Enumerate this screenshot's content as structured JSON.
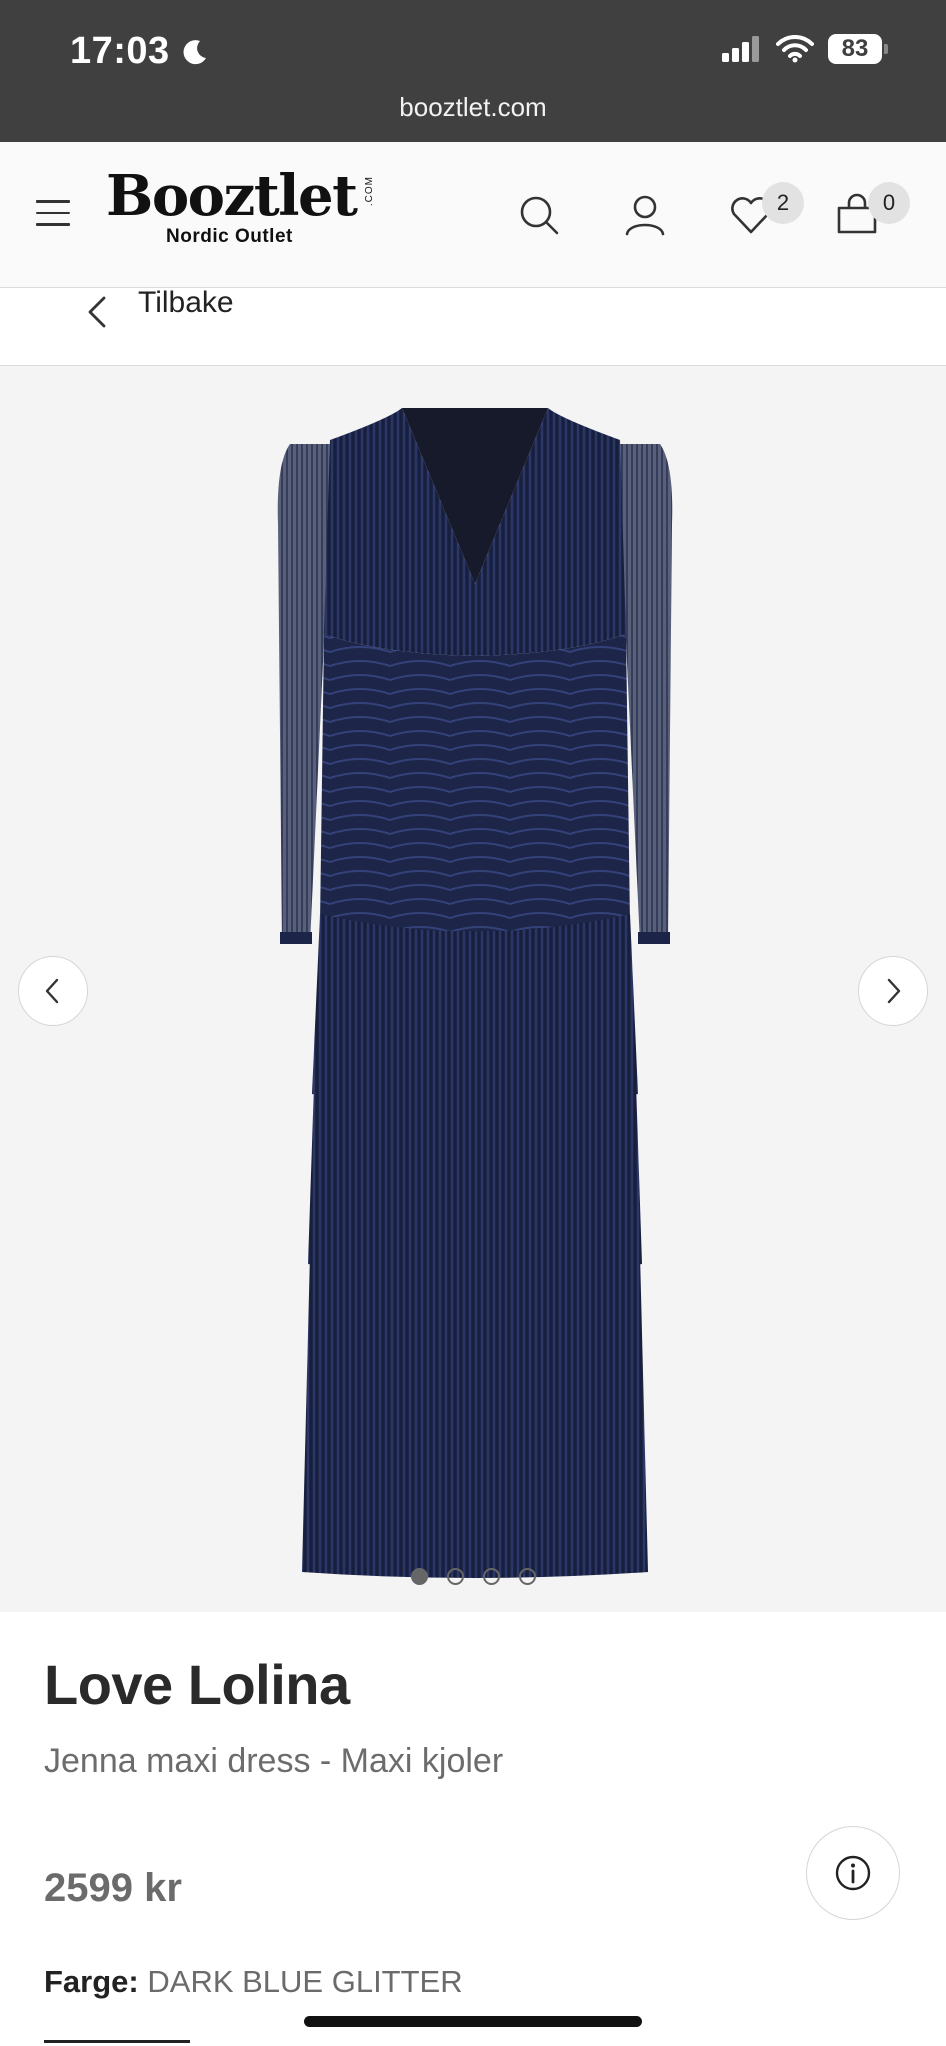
{
  "status_bar": {
    "time": "17:03",
    "battery": "83",
    "url": "booztlet.com"
  },
  "header": {
    "logo_word": "Booztlet",
    "logo_com": ".COM",
    "logo_tagline": "Nordic Outlet",
    "wishlist_count": "2",
    "cart_count": "0"
  },
  "back": {
    "label": "Tilbake"
  },
  "gallery": {
    "image_count": 4,
    "active_index": 0
  },
  "product": {
    "brand": "Love Lolina",
    "subtitle": "Jenna maxi dress - Maxi kjoler",
    "price": "2599 kr",
    "color_label": "Farge:",
    "color_value": "DARK BLUE GLITTER"
  },
  "colors": {
    "status_bg": "#404040",
    "header_bg": "#fafafa",
    "gallery_bg": "#f4f4f4",
    "dress": "#1c2447"
  }
}
